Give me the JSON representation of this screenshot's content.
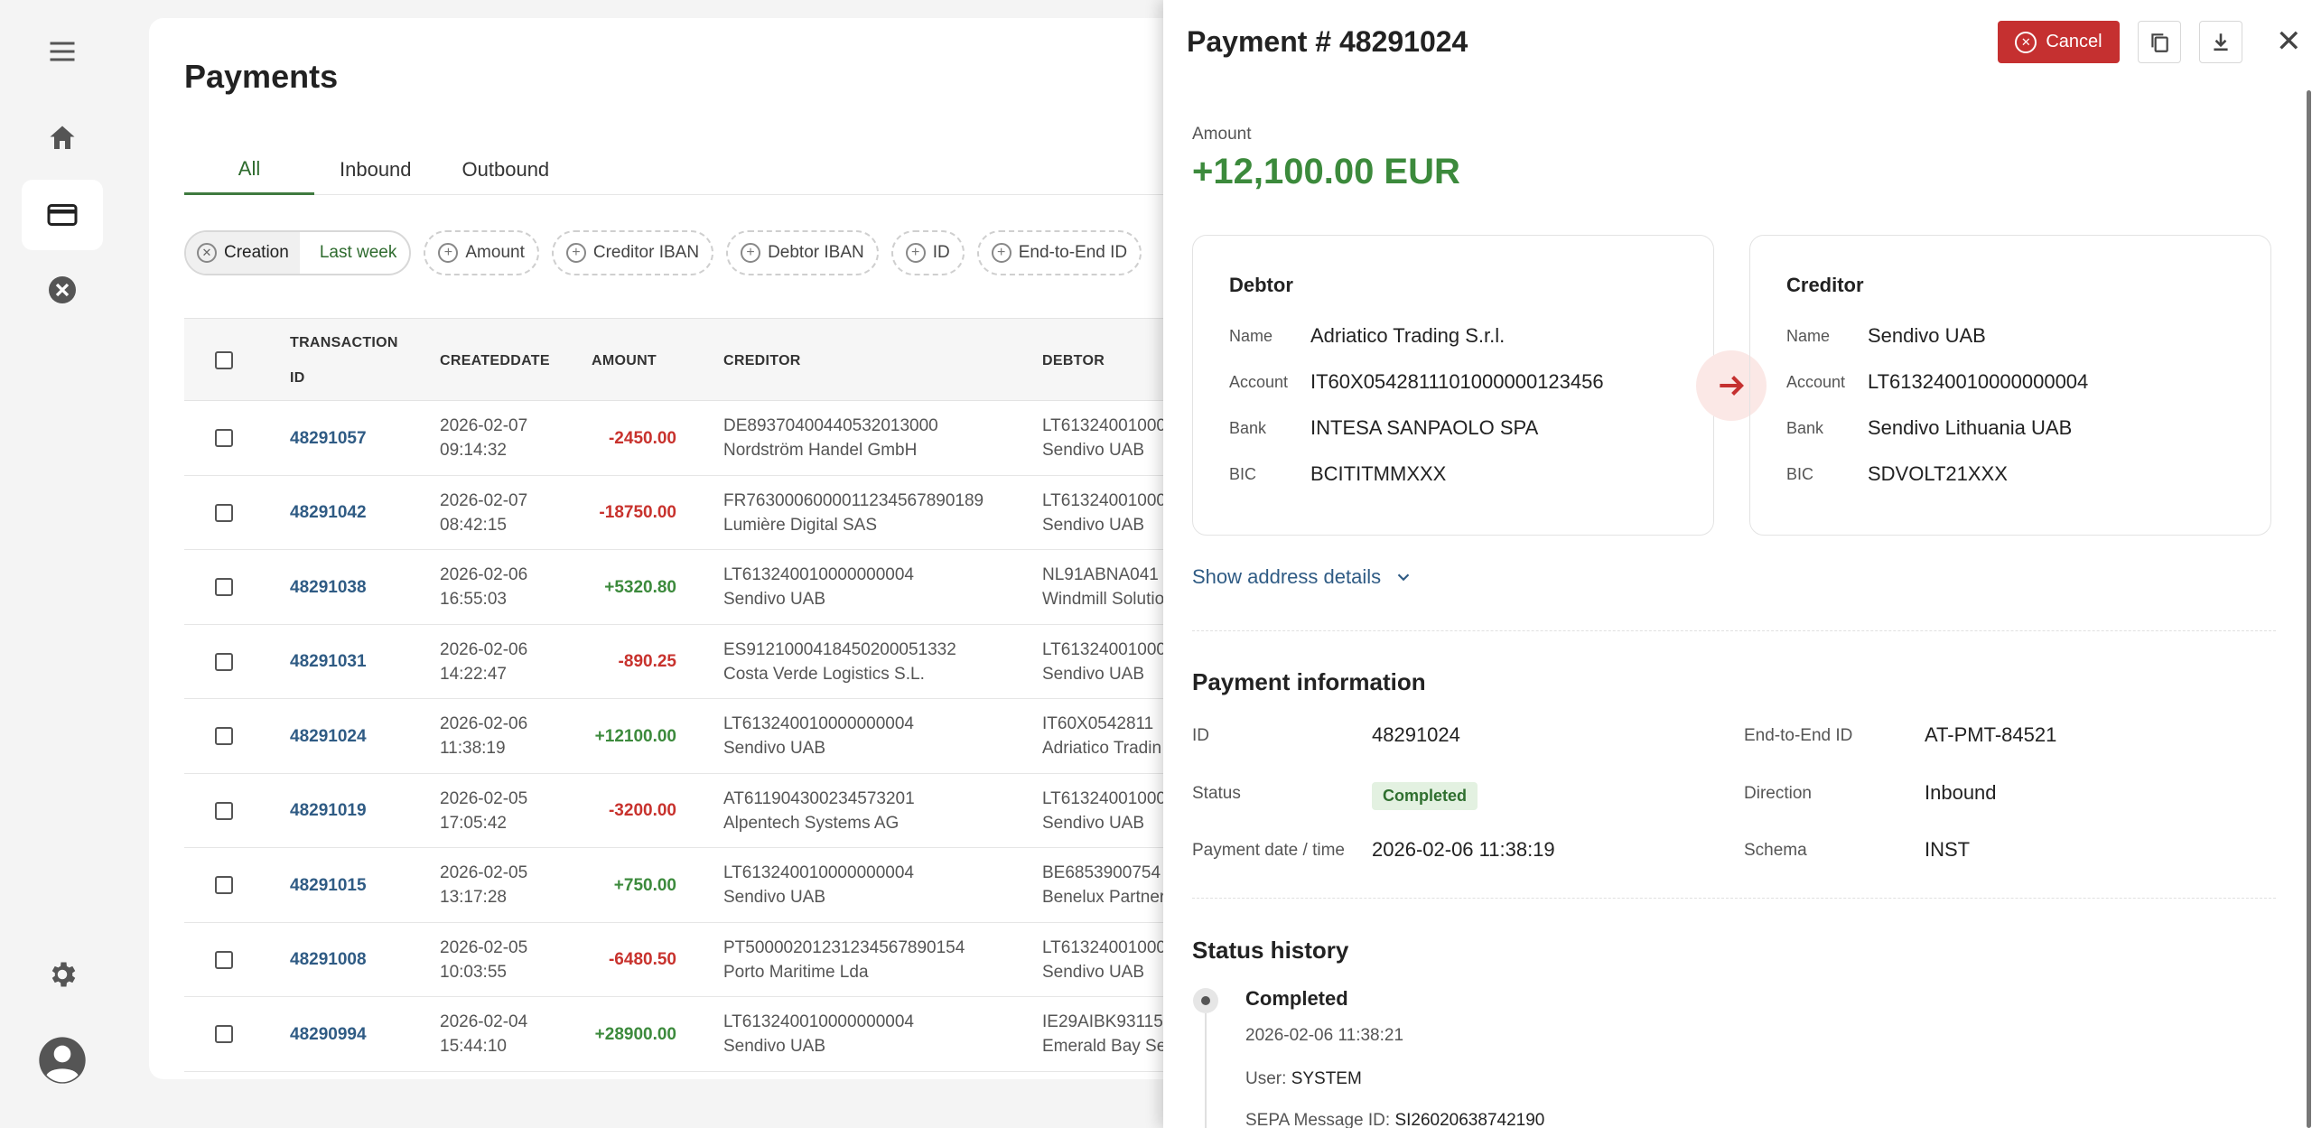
{
  "sidebar": {
    "items": [
      {
        "name": "menu-icon"
      },
      {
        "name": "home-icon"
      },
      {
        "name": "credit-card-icon"
      },
      {
        "name": "cancel-circle-icon"
      },
      {
        "name": "gear-icon"
      },
      {
        "name": "user-avatar-icon"
      }
    ]
  },
  "page": {
    "title": "Payments",
    "tabs": [
      "All",
      "Inbound",
      "Outbound"
    ],
    "active_tab": "All"
  },
  "filters": {
    "active": {
      "key": "Creation",
      "value": "Last week"
    },
    "add": [
      "Amount",
      "Creditor IBAN",
      "Debtor IBAN",
      "ID",
      "End-to-End ID"
    ]
  },
  "table": {
    "headers": {
      "transaction_id_1": "TRANSACTION",
      "transaction_id_2": "ID",
      "created": "CREATEDDATE",
      "amount": "AMOUNT",
      "creditor": "CREDITOR",
      "debtor": "DEBTOR"
    },
    "rows": [
      {
        "id": "48291057",
        "date": "2026-02-07",
        "time": "09:14:32",
        "amount": "-2450.00",
        "creditor_iban": "DE89370400440532013000",
        "creditor_name": "Nordström Handel GmbH",
        "debtor_iban": "LT61324001000",
        "debtor_name": "Sendivo UAB"
      },
      {
        "id": "48291042",
        "date": "2026-02-07",
        "time": "08:42:15",
        "amount": "-18750.00",
        "creditor_iban": "FR7630006000011234567890189",
        "creditor_name": "Lumière Digital SAS",
        "debtor_iban": "LT61324001000",
        "debtor_name": "Sendivo UAB"
      },
      {
        "id": "48291038",
        "date": "2026-02-06",
        "time": "16:55:03",
        "amount": "+5320.80",
        "creditor_iban": "LT613240010000000004",
        "creditor_name": "Sendivo UAB",
        "debtor_iban": "NL91ABNA041",
        "debtor_name": "Windmill Solutio"
      },
      {
        "id": "48291031",
        "date": "2026-02-06",
        "time": "14:22:47",
        "amount": "-890.25",
        "creditor_iban": "ES9121000418450200051332",
        "creditor_name": "Costa Verde Logistics S.L.",
        "debtor_iban": "LT61324001000",
        "debtor_name": "Sendivo UAB"
      },
      {
        "id": "48291024",
        "date": "2026-02-06",
        "time": "11:38:19",
        "amount": "+12100.00",
        "creditor_iban": "LT613240010000000004",
        "creditor_name": "Sendivo UAB",
        "debtor_iban": "IT60X0542811",
        "debtor_name": "Adriatico Tradin"
      },
      {
        "id": "48291019",
        "date": "2026-02-05",
        "time": "17:05:42",
        "amount": "-3200.00",
        "creditor_iban": "AT611904300234573201",
        "creditor_name": "Alpentech Systems AG",
        "debtor_iban": "LT61324001000",
        "debtor_name": "Sendivo UAB"
      },
      {
        "id": "48291015",
        "date": "2026-02-05",
        "time": "13:17:28",
        "amount": "+750.00",
        "creditor_iban": "LT613240010000000004",
        "creditor_name": "Sendivo UAB",
        "debtor_iban": "BE6853900754",
        "debtor_name": "Benelux Partner"
      },
      {
        "id": "48291008",
        "date": "2026-02-05",
        "time": "10:03:55",
        "amount": "-6480.50",
        "creditor_iban": "PT50000201231234567890154",
        "creditor_name": "Porto Maritime Lda",
        "debtor_iban": "LT61324001000",
        "debtor_name": "Sendivo UAB"
      },
      {
        "id": "48290994",
        "date": "2026-02-04",
        "time": "15:44:10",
        "amount": "+28900.00",
        "creditor_iban": "LT613240010000000004",
        "creditor_name": "Sendivo UAB",
        "debtor_iban": "IE29AIBK93115",
        "debtor_name": "Emerald Bay Ser"
      }
    ]
  },
  "panel": {
    "title": "Payment # 48291024",
    "cancel_label": "Cancel",
    "amount_label": "Amount",
    "amount_value": "+12,100.00 EUR",
    "debtor": {
      "title": "Debtor",
      "name_k": "Name",
      "name": "Adriatico Trading S.r.l.",
      "account_k": "Account",
      "account": "IT60X0542811101000000123456",
      "bank_k": "Bank",
      "bank": "INTESA SANPAOLO SPA",
      "bic_k": "BIC",
      "bic": "BCITITMMXXX"
    },
    "creditor": {
      "title": "Creditor",
      "name_k": "Name",
      "name": "Sendivo UAB",
      "account_k": "Account",
      "account": "LT613240010000000004",
      "bank_k": "Bank",
      "bank": "Sendivo Lithuania UAB",
      "bic_k": "BIC",
      "bic": "SDVOLT21XXX"
    },
    "show_address": "Show address details",
    "info": {
      "title": "Payment information",
      "id_k": "ID",
      "id": "48291024",
      "status_k": "Status",
      "status": "Completed",
      "date_k": "Payment date / time",
      "date": "2026-02-06 11:38:19",
      "e2e_k": "End-to-End ID",
      "e2e": "AT-PMT-84521",
      "direction_k": "Direction",
      "direction": "Inbound",
      "schema_k": "Schema",
      "schema": "INST"
    },
    "history": {
      "title": "Status history",
      "status": "Completed",
      "time": "2026-02-06 11:38:21",
      "user_k": "User:",
      "user": "SYSTEM",
      "sepa_k": "SEPA Message ID:",
      "sepa": "SI26020638742190"
    }
  },
  "colors": {
    "accent_green": "#3c8a3c",
    "danger_red": "#c53030",
    "link_blue": "#2f5b84"
  }
}
